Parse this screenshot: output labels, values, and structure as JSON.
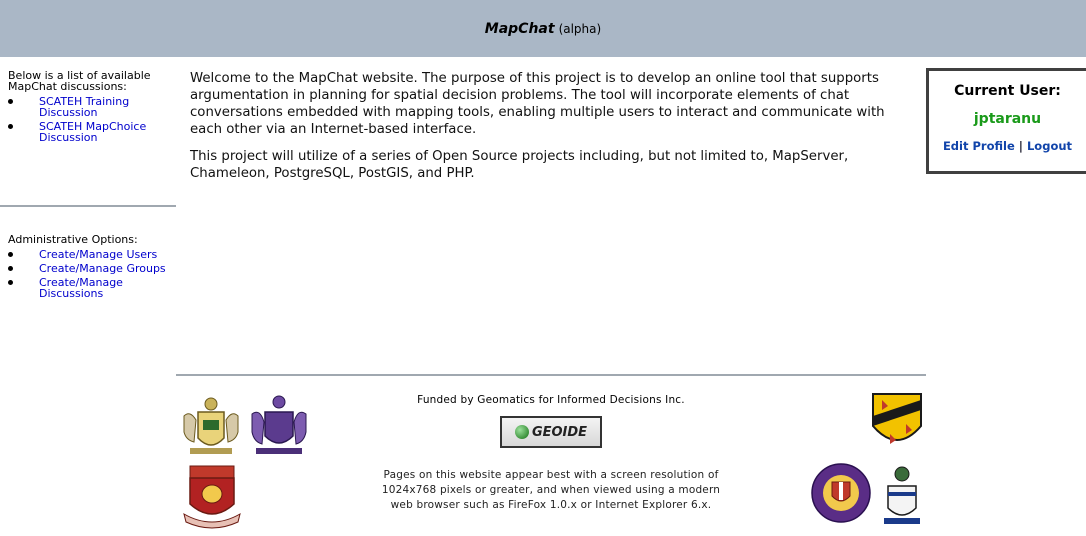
{
  "header": {
    "brand": "MapChat",
    "suffix": "(alpha)"
  },
  "sidebar": {
    "intro": "Below is a list of available MapChat discussions:",
    "discussions": [
      {
        "label": "SCATEH Training Discussion"
      },
      {
        "label": "SCATEH MapChoice Discussion"
      }
    ],
    "admin_title": "Administrative Options:",
    "admin_items": [
      {
        "label": "Create/Manage Users"
      },
      {
        "label": "Create/Manage Groups"
      },
      {
        "label": "Create/Manage Discussions"
      }
    ]
  },
  "main": {
    "paragraph1": "Welcome to the MapChat website. The purpose of this project is to develop an online tool that supports argumentation in planning for spatial decision problems. The tool will incorporate elements of chat conversations embedded with mapping tools, enabling multiple users to interact and communicate with each other via an Internet-based interface.",
    "paragraph2": "This project will utilize of a series of Open Source projects including, but not limited to, MapServer, Chameleon, PostgreSQL, PostGIS, and PHP."
  },
  "user": {
    "title": "Current User:",
    "username": "jptaranu",
    "edit_profile": "Edit Profile",
    "separator": "|",
    "logout": "Logout"
  },
  "footer": {
    "funded": "Funded by Geomatics for Informed Decisions Inc.",
    "geoide_logo": "GEOIDE",
    "footnote": "Pages on this website appear best with a screen resolution of 1024x768 pixels or greater, and when viewed using a modern web browser such as FireFox 1.0.x or Internet Explorer 6.x."
  },
  "colors": {
    "header_bg": "#aab7c6",
    "link": "#0000cc",
    "username": "#1a9a1a"
  }
}
